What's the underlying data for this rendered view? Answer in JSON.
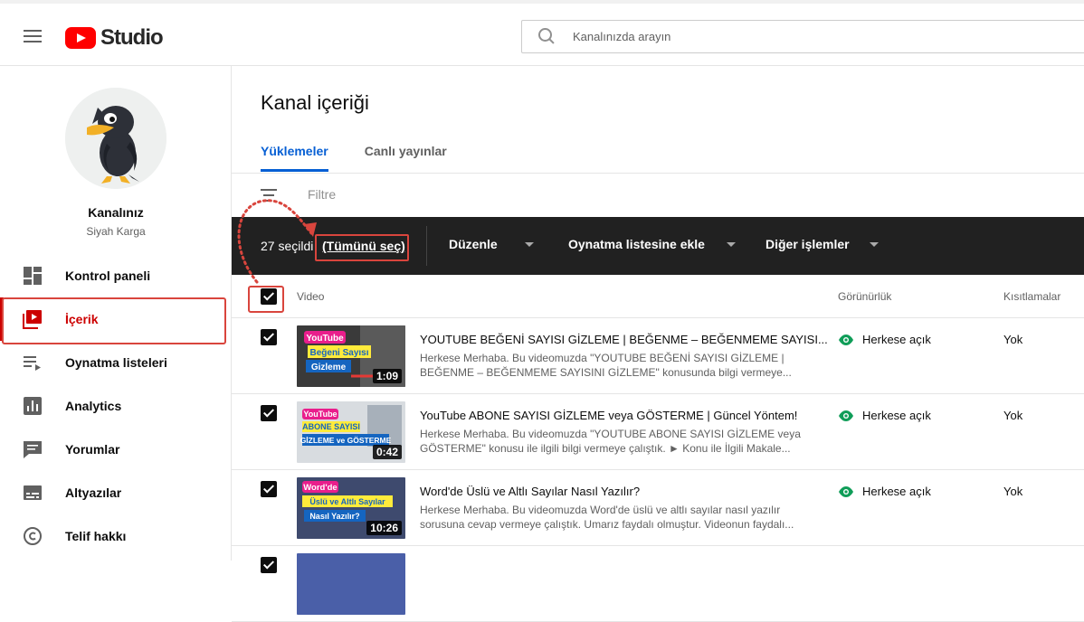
{
  "header": {
    "logo_text": "Studio",
    "search_placeholder": "Kanalınızda arayın"
  },
  "sidebar": {
    "channel_label": "Kanalınız",
    "channel_name": "Siyah Karga",
    "items": [
      {
        "label": "Kontrol paneli",
        "icon": "dashboard-icon"
      },
      {
        "label": "İçerik",
        "icon": "content-icon"
      },
      {
        "label": "Oynatma listeleri",
        "icon": "playlists-icon"
      },
      {
        "label": "Analytics",
        "icon": "analytics-icon"
      },
      {
        "label": "Yorumlar",
        "icon": "comments-icon"
      },
      {
        "label": "Altyazılar",
        "icon": "subtitles-icon"
      },
      {
        "label": "Telif hakkı",
        "icon": "copyright-icon"
      }
    ]
  },
  "main": {
    "title": "Kanal içeriği",
    "tabs": [
      {
        "label": "Yüklemeler"
      },
      {
        "label": "Canlı yayınlar"
      }
    ],
    "filter_placeholder": "Filtre",
    "action_bar": {
      "selected_count": "27 seçildi",
      "select_all": "(Tümünü seç)",
      "edit": "Düzenle",
      "add_to_playlist": "Oynatma listesine ekle",
      "more_actions": "Diğer işlemler"
    },
    "columns": {
      "video": "Video",
      "visibility": "Görünürlük",
      "restrictions": "Kısıtlamalar"
    },
    "videos": [
      {
        "title": "YOUTUBE BEĞENİ SAYISI GİZLEME | BEĞENME – BEĞENMEME SAYISI...",
        "desc_line1": "Herkese Merhaba. Bu videomuzda \"YOUTUBE BEĞENİ SAYISI GİZLEME |",
        "desc_line2": "BEĞENME – BEĞENMEME SAYISINI GİZLEME\" konusunda bilgi vermeye...",
        "duration": "1:09",
        "thumb_line1": "YouTube",
        "thumb_line2": "Beğeni Sayısı",
        "thumb_line3": "Gizleme",
        "visibility": "Herkese açık",
        "restrictions": "Yok"
      },
      {
        "title": "YouTube ABONE SAYISI GİZLEME veya GÖSTERME | Güncel Yöntem!",
        "desc_line1": "Herkese Merhaba. Bu videomuzda \"YOUTUBE ABONE SAYISI GİZLEME veya",
        "desc_line2": "GÖSTERME\" konusu ile ilgili bilgi vermeye çalıştık. ► Konu ile İlgili Makale...",
        "duration": "0:42",
        "thumb_line1": "YouTube",
        "thumb_line2": "ABONE SAYISI",
        "thumb_line3": "GİZLEME ve GÖSTERME",
        "visibility": "Herkese açık",
        "restrictions": "Yok"
      },
      {
        "title": "Word'de Üslü ve Altlı Sayılar Nasıl Yazılır?",
        "desc_line1": "Herkese Merhaba. Bu videomuzda Word'de üslü ve altlı sayılar nasıl yazılır",
        "desc_line2": "sorusuna cevap vermeye çalıştık. Umarız faydalı olmuştur. Videonun faydalı...",
        "duration": "10:26",
        "thumb_line1": "Word'de",
        "thumb_line2": "Üslü ve Altlı Sayılar",
        "thumb_line3": "Nasıl Yazılır?",
        "visibility": "Herkese açık",
        "restrictions": "Yok"
      }
    ]
  },
  "colors": {
    "accent_red": "#cc0000",
    "link_blue": "#065fd4",
    "annotation_red": "#d9453d",
    "visibility_green": "#0f9d58",
    "action_bar_bg": "#212121"
  }
}
